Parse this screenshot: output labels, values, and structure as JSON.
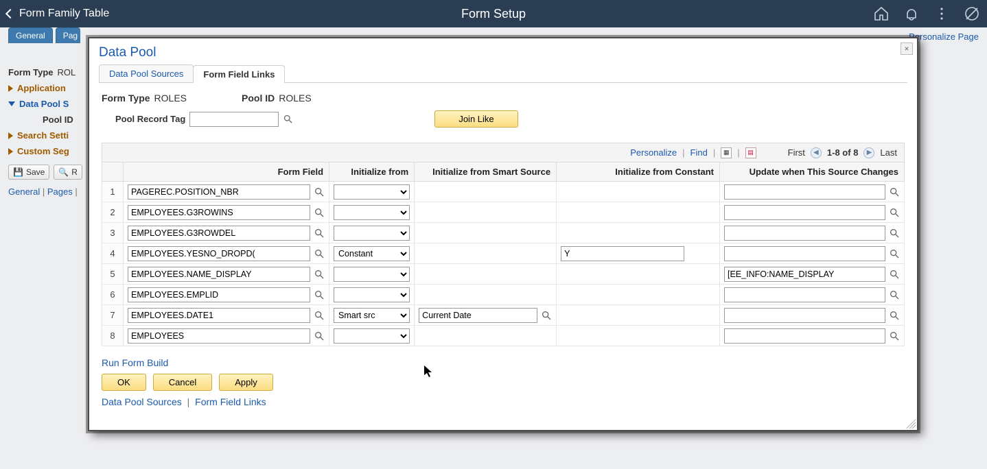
{
  "topbar": {
    "back_label": "Form Family Table",
    "title": "Form Setup"
  },
  "top_right_link": "Personalize Page",
  "bg": {
    "tabs": [
      "General",
      "Pag"
    ],
    "form_type_label": "Form Type",
    "form_type_value": "ROL",
    "sections": {
      "app": "Application",
      "data_pool": "Data Pool S",
      "pool_id": "Pool ID",
      "search": "Search Setti",
      "custom": "Custom Seg"
    },
    "save_btn": "Save",
    "refresh_btn": "R",
    "footer_links": [
      "General",
      "Pages"
    ]
  },
  "modal": {
    "title": "Data Pool",
    "tabs": {
      "sources": "Data Pool Sources",
      "links": "Form Field Links"
    },
    "form_type_label": "Form Type",
    "form_type_value": "ROLES",
    "pool_id_label": "Pool ID",
    "pool_id_value": "ROLES",
    "pool_record_tag_label": "Pool Record Tag",
    "pool_record_tag_value": "",
    "join_like_label": "Join Like",
    "grid_nav": {
      "personalize": "Personalize",
      "find": "Find",
      "first": "First",
      "range": "1-8 of 8",
      "last": "Last"
    },
    "columns": {
      "form_field": "Form Field",
      "init_from": "Initialize from",
      "init_smart": "Initialize from Smart Source",
      "init_const": "Initialize from Constant",
      "update_when": "Update when This Source Changes"
    },
    "init_from_options": [
      "",
      "Constant",
      "Smart src"
    ],
    "rows": [
      {
        "n": "1",
        "form_field": "PAGEREC.POSITION_NBR",
        "init_from": "",
        "smart_src": "",
        "constant": "",
        "update_src": ""
      },
      {
        "n": "2",
        "form_field": "EMPLOYEES.G3ROWINS",
        "init_from": "",
        "smart_src": "",
        "constant": "",
        "update_src": ""
      },
      {
        "n": "3",
        "form_field": "EMPLOYEES.G3ROWDEL",
        "init_from": "",
        "smart_src": "",
        "constant": "",
        "update_src": ""
      },
      {
        "n": "4",
        "form_field": "EMPLOYEES.YESNO_DROPD(",
        "init_from": "Constant",
        "smart_src": "",
        "constant": "Y",
        "update_src": ""
      },
      {
        "n": "5",
        "form_field": "EMPLOYEES.NAME_DISPLAY",
        "init_from": "",
        "smart_src": "",
        "constant": "",
        "update_src": "[EE_INFO:NAME_DISPLAY"
      },
      {
        "n": "6",
        "form_field": "EMPLOYEES.EMPLID",
        "init_from": "",
        "smart_src": "",
        "constant": "",
        "update_src": ""
      },
      {
        "n": "7",
        "form_field": "EMPLOYEES.DATE1",
        "init_from": "Smart src",
        "smart_src": "Current Date",
        "constant": "",
        "update_src": ""
      },
      {
        "n": "8",
        "form_field": "EMPLOYEES",
        "init_from": "",
        "smart_src": "",
        "constant": "",
        "update_src": ""
      }
    ],
    "run_build": "Run Form Build",
    "buttons": {
      "ok": "OK",
      "cancel": "Cancel",
      "apply": "Apply"
    },
    "bottom_links": {
      "sources": "Data Pool Sources",
      "links": "Form Field Links"
    }
  }
}
